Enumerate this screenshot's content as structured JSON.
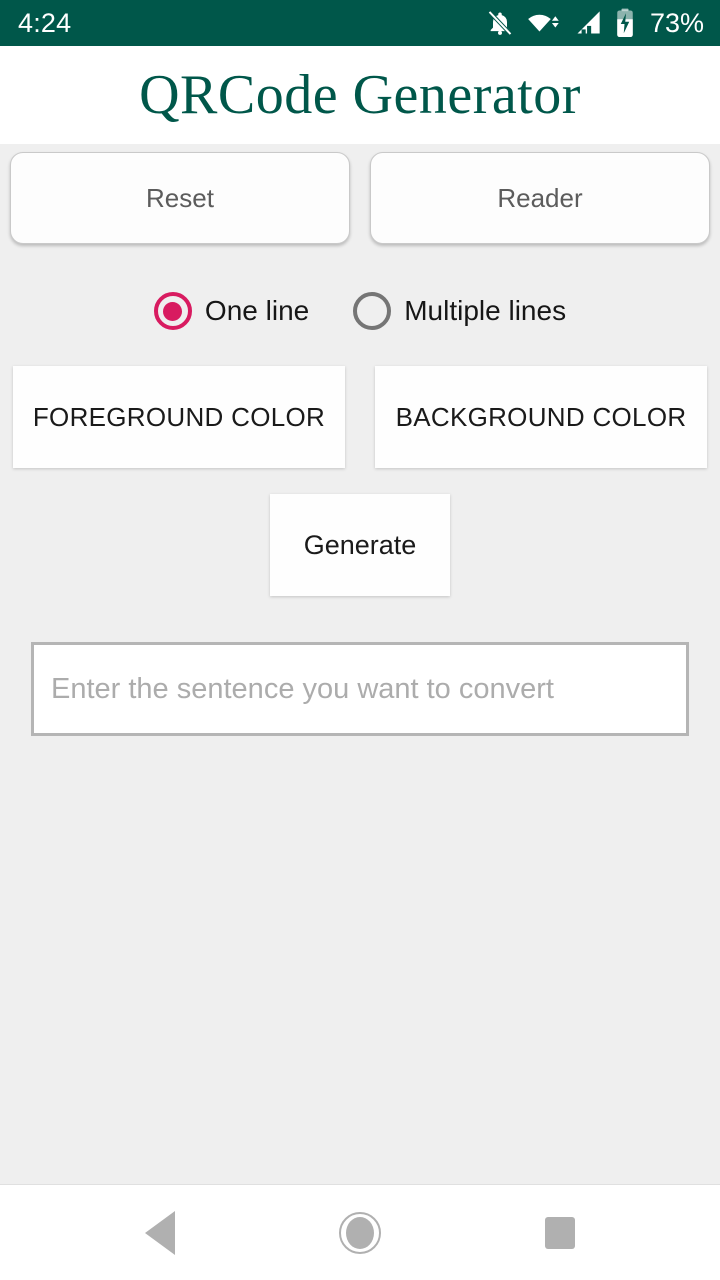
{
  "status_bar": {
    "time": "4:24",
    "battery_percent": "73%",
    "background_color": "#00574A",
    "icons": [
      "notifications-off-icon",
      "wifi-icon",
      "cellular-signal-icon",
      "battery-charging-icon"
    ]
  },
  "header": {
    "title": "QRCode Generator",
    "title_color": "#00574A"
  },
  "toolbar": {
    "reset_label": "Reset",
    "reader_label": "Reader"
  },
  "line_mode": {
    "options": [
      {
        "label": "One line",
        "selected": true
      },
      {
        "label": "Multiple lines",
        "selected": false
      }
    ],
    "selected_color": "#D81B60",
    "unselected_color": "#757575"
  },
  "color_buttons": {
    "foreground_label": "FOREGROUND COLOR",
    "background_label": "BACKGROUND COLOR"
  },
  "generate": {
    "label": "Generate"
  },
  "input": {
    "placeholder": "Enter the sentence you want to convert",
    "value": ""
  },
  "nav_bar": {
    "back_label": "Back",
    "home_label": "Home",
    "recents_label": "Recents"
  }
}
